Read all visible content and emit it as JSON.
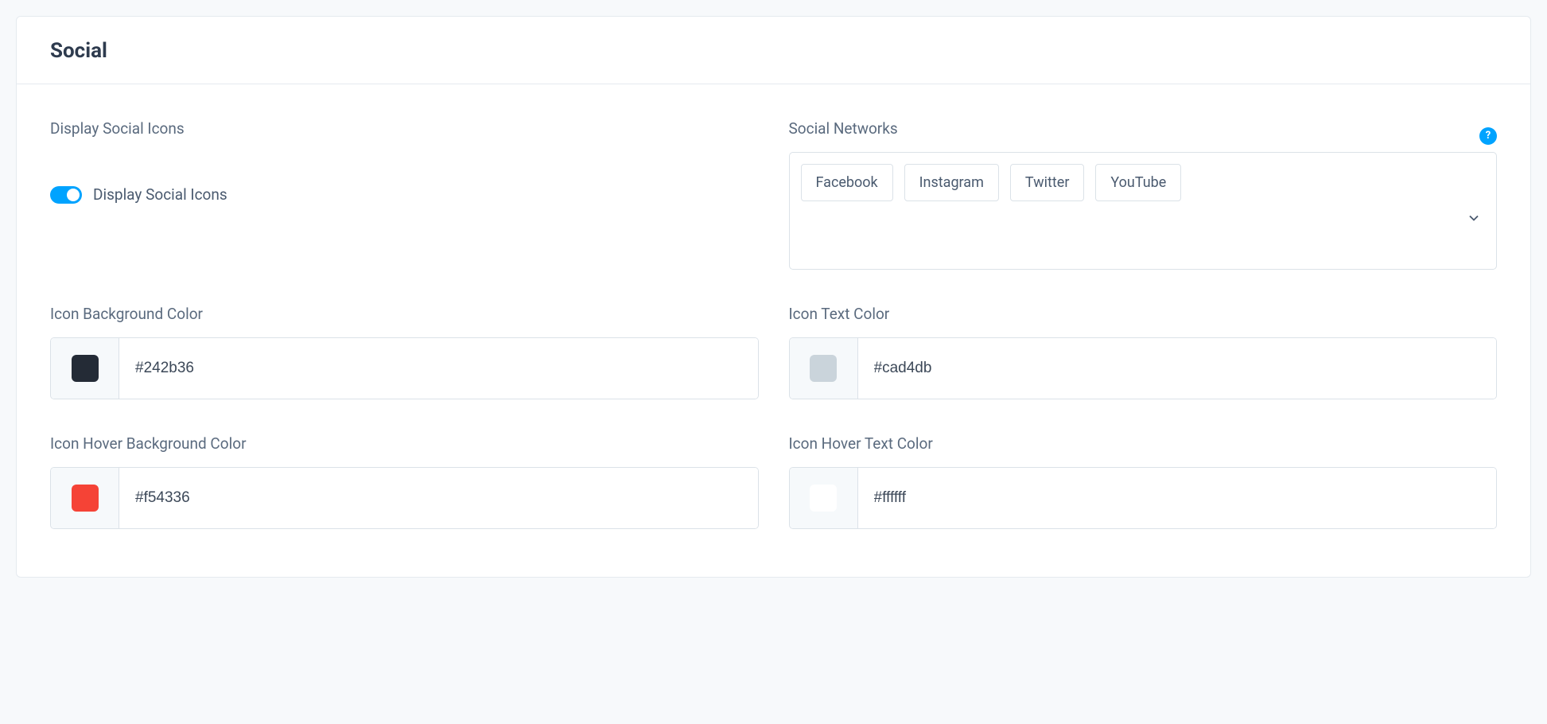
{
  "header": {
    "title": "Social"
  },
  "displaySocial": {
    "heading": "Display Social Icons",
    "toggleLabel": "Display Social Icons",
    "enabled": true
  },
  "socialNetworks": {
    "heading": "Social Networks",
    "help": "?",
    "selected": [
      "Facebook",
      "Instagram",
      "Twitter",
      "YouTube"
    ]
  },
  "colors": {
    "iconBg": {
      "label": "Icon Background Color",
      "value": "#242b36",
      "swatch": "#242b36"
    },
    "iconText": {
      "label": "Icon Text Color",
      "value": "#cad4db",
      "swatch": "#cad4db"
    },
    "iconHoverBg": {
      "label": "Icon Hover Background Color",
      "value": "#f54336",
      "swatch": "#f54336"
    },
    "iconHoverText": {
      "label": "Icon Hover Text Color",
      "value": "#ffffff",
      "swatch": "#ffffff"
    }
  }
}
